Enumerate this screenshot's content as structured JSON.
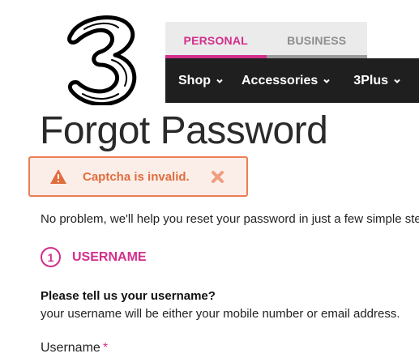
{
  "brand": {
    "logo_icon": "three-logo-icon",
    "accent_color": "#d32e8b"
  },
  "segment_tabs": [
    {
      "label": "PERSONAL",
      "active": true
    },
    {
      "label": "BUSINESS",
      "active": false
    }
  ],
  "nav": {
    "items": [
      {
        "label": "Shop",
        "icon": "chevron-down-icon"
      },
      {
        "label": "Accessories",
        "icon": "chevron-down-icon"
      },
      {
        "label": "3Plus",
        "icon": "chevron-down-icon"
      }
    ]
  },
  "page": {
    "title": "Forgot Password"
  },
  "alert": {
    "message": "Captcha is invalid.",
    "icon": "warning-icon",
    "close_icon": "close-icon",
    "color": "#e06d3e"
  },
  "intro_text": "No problem, we'll help you reset your password in just a few simple steps.",
  "step": {
    "number": "1",
    "label": "USERNAME"
  },
  "form": {
    "question": "Please tell us your username?",
    "hint": "your username will be either your mobile number or email address.",
    "username_label": "Username",
    "required_marker": "*"
  }
}
